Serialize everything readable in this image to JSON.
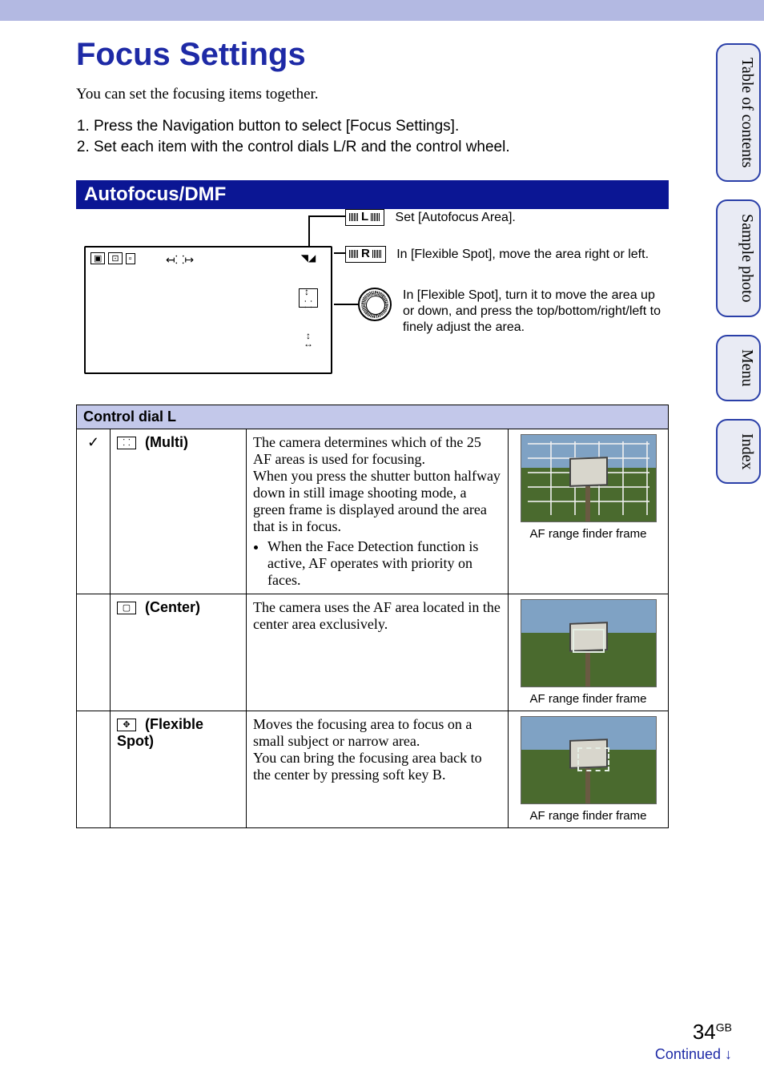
{
  "title": "Focus Settings",
  "intro": "You can set the focusing items together.",
  "steps": [
    "Press the Navigation button to select [Focus Settings].",
    "Set each item with the control dials L/R and the control wheel."
  ],
  "section_heading": "Autofocus/DMF",
  "diagram": {
    "dial_L_label": "L",
    "dial_R_label": "R",
    "callout_L": "Set [Autofocus Area].",
    "callout_R": "In [Flexible Spot], move the area right or left.",
    "callout_wheel": "In [Flexible Spot], turn it to move the area up or down, and press the top/bottom/right/left to finely adjust the area."
  },
  "table": {
    "header": "Control dial L",
    "rows": [
      {
        "default_mark": "✓",
        "name": " (Multi)",
        "desc_main": "The camera determines which of the 25 AF areas is used for focusing.\nWhen you press the shutter button halfway down in still image shooting mode, a green frame is displayed around the area that is in focus.",
        "desc_bullet": "When the Face Detection function is active, AF operates with priority on faces.",
        "caption": "AF range finder frame"
      },
      {
        "default_mark": "",
        "name": " (Center)",
        "desc_main": "The camera uses the AF area located in the center area exclusively.",
        "desc_bullet": "",
        "caption": "AF range finder frame"
      },
      {
        "default_mark": "",
        "name": " (Flexible Spot)",
        "desc_main": "Moves the focusing area to focus on a small subject or narrow area.\nYou can bring the focusing area back to the center by pressing soft key B.",
        "desc_bullet": "",
        "caption": "AF range finder frame"
      }
    ]
  },
  "side_tabs": [
    "Table of contents",
    "Sample photo",
    "Menu",
    "Index"
  ],
  "page_number": "34",
  "page_region": "GB",
  "continued": "Continued ↓"
}
